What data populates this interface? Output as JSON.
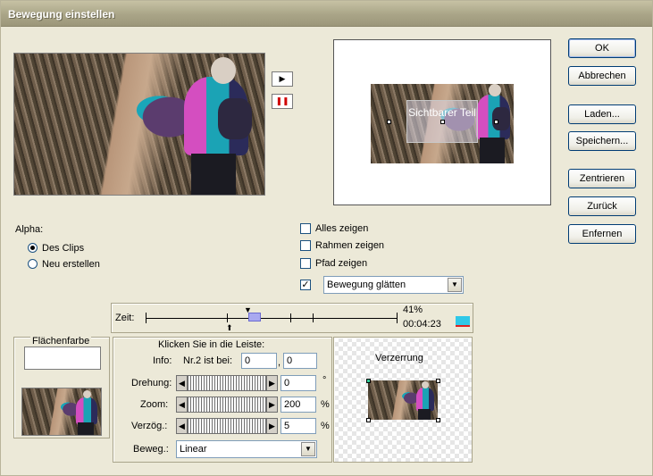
{
  "window": {
    "title": "Bewegung einstellen"
  },
  "buttons": {
    "ok": "OK",
    "cancel": "Abbrechen",
    "load": "Laden...",
    "save": "Speichern...",
    "center": "Zentrieren",
    "reset": "Zurück",
    "remove": "Enfernen"
  },
  "motion_area": {
    "visible_label": "Sichtbarer Teil"
  },
  "alpha": {
    "label": "Alpha:",
    "options": [
      "Des Clips",
      "Neu erstellen"
    ],
    "selected": "Des Clips"
  },
  "options": {
    "show_all": {
      "label": "Alles zeigen",
      "checked": false
    },
    "show_frame": {
      "label": "Rahmen zeigen",
      "checked": false
    },
    "show_path": {
      "label": "Pfad zeigen",
      "checked": false
    },
    "smooth": {
      "checked": true,
      "value": "Bewegung glätten"
    }
  },
  "timeline": {
    "label": "Zeit:",
    "percent": "41%",
    "timecode": "00:04:23"
  },
  "fill": {
    "label": "Flächenfarbe"
  },
  "controls": {
    "hint": "Klicken Sie in die Leiste:",
    "info_label": "Info:",
    "info_text": "Nr.2 ist bei:",
    "info_x": "0",
    "info_y": "0",
    "info_sep": ",",
    "rotation_label": "Drehung:",
    "rotation_value": "0",
    "rotation_unit": "°",
    "zoom_label": "Zoom:",
    "zoom_value": "200",
    "zoom_unit": "%",
    "delay_label": "Verzög.:",
    "delay_value": "5",
    "delay_unit": "%",
    "motion_label": "Beweg.:",
    "motion_value": "Linear"
  },
  "distortion": {
    "label": "Verzerrung"
  },
  "icons": {
    "play": "play-icon",
    "pause": "pause-icon",
    "dropdown": "chevron-down-icon",
    "slider_left": "arrow-left-icon",
    "slider_right": "arrow-right-icon"
  }
}
